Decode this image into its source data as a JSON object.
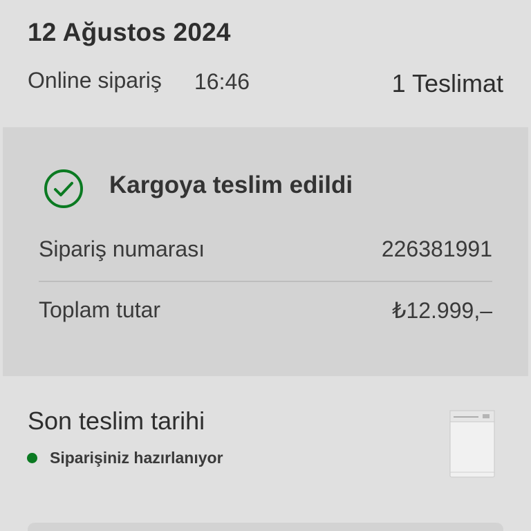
{
  "order": {
    "date": "12 Ağustos 2024",
    "type": "Online sipariş",
    "time": "16:46",
    "delivery_count": "1 Teslimat"
  },
  "status_card": {
    "icon": "check-circle-icon",
    "status_color": "#0b7a22",
    "title": "Kargoya teslim edildi",
    "order_number_label": "Sipariş numarası",
    "order_number_value": "226381991",
    "total_label": "Toplam tutar",
    "total_value": "₺12.999,–"
  },
  "delivery": {
    "title": "Son teslim tarihi",
    "status": "Siparişiniz hazırlanıyor",
    "status_color": "#0b7a22",
    "product_icon": "dishwasher-icon"
  }
}
